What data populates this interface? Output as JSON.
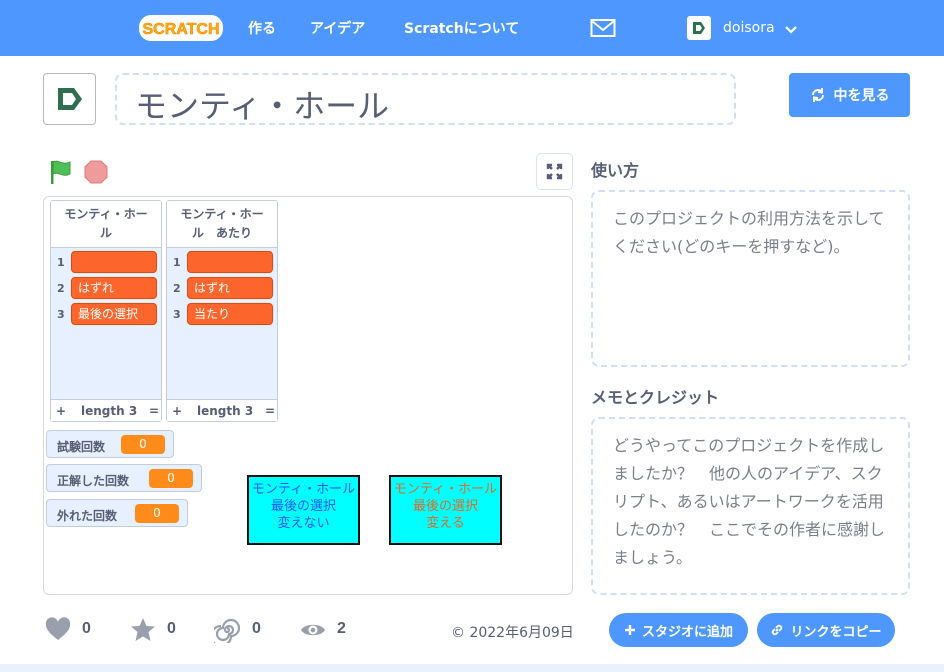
{
  "nav": {
    "logo": "SCRATCH",
    "links": [
      "作る",
      "アイデア",
      "Scratchについて"
    ],
    "username": "doisora"
  },
  "project": {
    "title": "モンティ・ホール",
    "see_inside": "中を見る"
  },
  "stage": {
    "lists": [
      {
        "name": "モンティ・ホール",
        "items": [
          {
            "index": "1",
            "value": ""
          },
          {
            "index": "2",
            "value": "はずれ"
          },
          {
            "index": "3",
            "value": "最後の選択"
          }
        ],
        "length_label": "length 3",
        "plus": "+",
        "eq": "="
      },
      {
        "name": "モンティ・ホール　あたり",
        "items": [
          {
            "index": "1",
            "value": ""
          },
          {
            "index": "2",
            "value": "はずれ"
          },
          {
            "index": "3",
            "value": "当たり"
          }
        ],
        "length_label": "length 3",
        "plus": "+",
        "eq": "="
      }
    ],
    "monitors": [
      {
        "label": "試験回数",
        "value": "0"
      },
      {
        "label": "正解した回数",
        "value": "0"
      },
      {
        "label": "外れた回数",
        "value": "0"
      }
    ],
    "buttons": [
      {
        "line1": "モンティ・ホール",
        "line2": "最後の選択",
        "line3": "変えない",
        "text_color": "#2255ff"
      },
      {
        "line1": "モンティ・ホール",
        "line2": "最後の選択",
        "line3": "変える",
        "text_color": "#e06a2a"
      }
    ]
  },
  "instructions": {
    "title": "使い方",
    "text": "このプロジェクトの利用方法を示してください(どのキーを押すなど)。"
  },
  "notes": {
    "title": "メモとクレジット",
    "text": "どうやってこのプロジェクトを作成しましたか？　他の人のアイデア、スクリプト、あるいはアートワークを活用したのか？　ここでその作者に感謝しましょう。"
  },
  "stats": {
    "loves": "0",
    "favorites": "0",
    "remixes": "0",
    "views": "2"
  },
  "date": "2022年6月09日",
  "actions": {
    "add_to_studio": "スタジオに追加",
    "copy_link": "リンクをコピー"
  },
  "colors": {
    "brand_blue": "#4d97ff",
    "list_item": "#fc662c",
    "monitor_value": "#ff8c1a",
    "sprite_bg": "#00ffff"
  }
}
